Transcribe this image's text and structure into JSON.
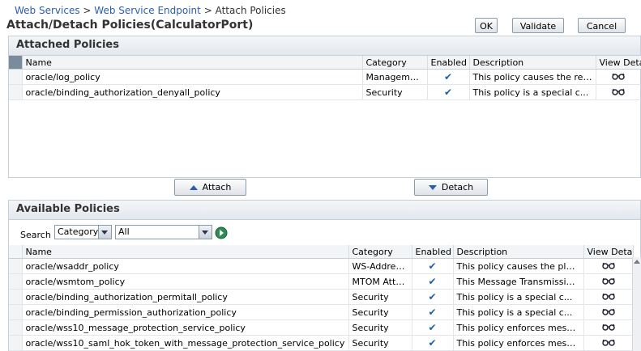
{
  "breadcrumb": {
    "items": [
      "Web Services",
      "Web Service Endpoint",
      "Attach Policies"
    ],
    "separator": ">"
  },
  "page_title": "Attach/Detach Policies(CalculatorPort)",
  "toolbar": {
    "ok": "OK",
    "validate": "Validate",
    "cancel": "Cancel"
  },
  "attached": {
    "title": "Attached Policies",
    "columns": [
      "Name",
      "Category",
      "Enabled",
      "Description",
      "View Detail"
    ],
    "rows": [
      {
        "name": "oracle/log_policy",
        "category": "Management",
        "description": "This policy causes the req..."
      },
      {
        "name": "oracle/binding_authorization_denyall_policy",
        "category": "Security",
        "description": "This policy is a special c..."
      }
    ]
  },
  "actions": {
    "attach": "Attach",
    "detach": "Detach"
  },
  "available": {
    "title": "Available Policies",
    "search_label": "Search",
    "search_field": "Category",
    "search_value": "All",
    "columns": [
      "Name",
      "Category",
      "Enabled",
      "Description",
      "View Detail"
    ],
    "rows": [
      {
        "name": "oracle/wsaddr_policy",
        "category": "WS-Addres...",
        "description": "This policy causes the pla..."
      },
      {
        "name": "oracle/wsmtom_policy",
        "category": "MTOM Atta...",
        "description": "This Message Transmission ..."
      },
      {
        "name": "oracle/binding_authorization_permitall_policy",
        "category": "Security",
        "description": "This policy is a special c..."
      },
      {
        "name": "oracle/binding_permission_authorization_policy",
        "category": "Security",
        "description": "This policy is a special c..."
      },
      {
        "name": "oracle/wss10_message_protection_service_policy",
        "category": "Security",
        "description": "This policy enforces messa..."
      },
      {
        "name": "oracle/wss10_saml_hok_token_with_message_protection_service_policy",
        "category": "Security",
        "description": "This policy enforces messa..."
      }
    ]
  },
  "colors": {
    "link": "#2a5db0",
    "check": "#1f5fa8",
    "go": "#2e8b57"
  }
}
